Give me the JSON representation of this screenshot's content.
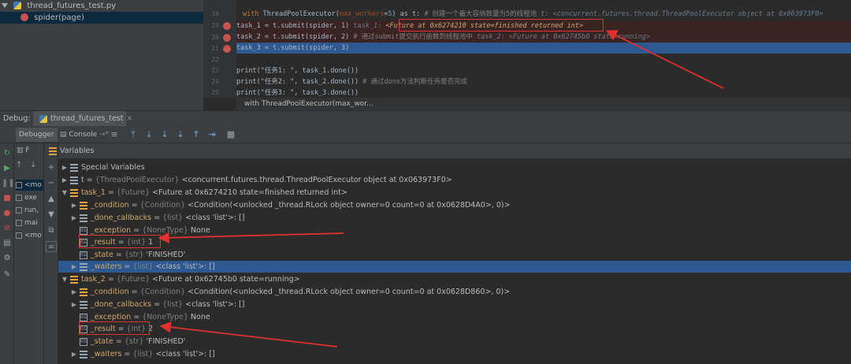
{
  "structure": {
    "file": "thread_futures_test.py",
    "child": "spider(page)"
  },
  "editor": {
    "lines": [
      {
        "no": "18"
      },
      {
        "no": "19"
      },
      {
        "no": "20"
      },
      {
        "no": "21"
      },
      {
        "no": "22"
      },
      {
        "no": "23"
      },
      {
        "no": "24"
      },
      {
        "no": "25"
      }
    ],
    "l18_with": "with ",
    "l18_call": "ThreadPoolExecutor(",
    "l18_param": "max_workers",
    "l18_eq": "=",
    "l18_num": "5",
    "l18_as": ") as t:",
    "l18_comment": "  # 创建一个最大容纳数量为5的线程池",
    "l18_hint": "  t: <concurrent.futures.thread.ThreadPoolExecutor object at 0x063973F0>",
    "l19_code": "    task_1 = t.submit(spider, 1)",
    "l19_hint_name": "  task_1: ",
    "l19_hint_val": "<Future at 0x6274210 state=finished returned int>",
    "l20_code": "    task_2 = t.submit(spider, 2)",
    "l20_comment": "  # 通过submit提交执行函数到线程池中",
    "l20_hint": "  task_2: <Future at 0x62745b0 state=running>",
    "l21_code": "    task_3 = t.submit(spider, 3)",
    "l23_code": "    print(\"任务1: \", task_1.done())",
    "l24_code": "    print(\"任务2: \", task_2.done())",
    "l24_comment": "  # 通过done方法判断任务是否完成",
    "l25_code": "    print(\"任务3: \", task_3.done())",
    "breadcrumb": "with ThreadPoolExecutor(max_wor..."
  },
  "debug": {
    "label": "Debug:",
    "run_tab": "thread_futures_test",
    "tabs": {
      "debugger": "Debugger",
      "console": "Console"
    },
    "frames_header": "F",
    "frames": [
      "<mo",
      "exe",
      "run,",
      "mai",
      "<mo"
    ],
    "variables_header": "Variables"
  },
  "variables": {
    "special": "Special Variables",
    "t": {
      "name": "t",
      "type": "{ThreadPoolExecutor}",
      "value": "<concurrent.futures.thread.ThreadPoolExecutor object at 0x063973F0>"
    },
    "task1": {
      "name": "task_1",
      "type": "{Future}",
      "value": "<Future at 0x6274210 state=finished returned int>"
    },
    "task1_condition": {
      "name": "_condition",
      "type": "{Condition}",
      "value": "<Condition(<unlocked _thread.RLock object owner=0 count=0 at 0x0628D4A0>, 0)>"
    },
    "task1_done_callbacks": {
      "name": "_done_callbacks",
      "type": "{list}",
      "value": "<class 'list'>: []"
    },
    "task1_exception": {
      "name": "_exception",
      "type": "{NoneType}",
      "value": "None"
    },
    "task1_result": {
      "name": "_result",
      "type": "{int}",
      "value": "1"
    },
    "task1_state": {
      "name": "_state",
      "type": "{str}",
      "value": "'FINISHED'"
    },
    "task1_waiters": {
      "name": "_waiters",
      "type": "{list}",
      "value": "<class 'list'>: []"
    },
    "task2": {
      "name": "task_2",
      "type": "{Future}",
      "value": "<Future at 0x62745b0 state=running>"
    },
    "task2_condition": {
      "name": "_condition",
      "type": "{Condition}",
      "value": "<Condition(<unlocked _thread.RLock object owner=0 count=0 at 0x0628D860>, 0)>"
    },
    "task2_done_callbacks": {
      "name": "_done_callbacks",
      "type": "{list}",
      "value": "<class 'list'>: []"
    },
    "task2_exception": {
      "name": "_exception",
      "type": "{NoneType}",
      "value": "None"
    },
    "task2_result": {
      "name": "_result",
      "type": "{int}",
      "value": "2"
    },
    "task2_state": {
      "name": "_state",
      "type": "{str}",
      "value": "'FINISHED'"
    },
    "task2_waiters": {
      "name": "_waiters",
      "type": "{list}",
      "value": "<class 'list'>: []"
    }
  },
  "colors": {
    "annotation": "#e03030",
    "selection": "#2d5890",
    "breakpoint": "#c75450"
  }
}
